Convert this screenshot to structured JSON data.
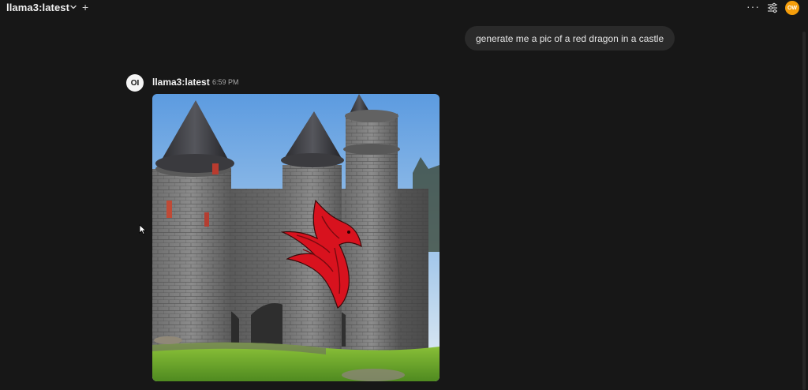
{
  "header": {
    "model_title": "llama3:latest",
    "new_chat_icon": "plus-icon",
    "more_icon": "ellipsis-icon",
    "settings_icon": "sliders-icon",
    "avatar_initials": "OW"
  },
  "colors": {
    "background": "#171717",
    "bubble": "#2a2a2a",
    "avatar": "#f59e0b"
  },
  "messages": [
    {
      "role": "user",
      "text": "generate me a pic of a red dragon in a castle"
    },
    {
      "role": "assistant",
      "logo_text": "OI",
      "model": "llama3:latest",
      "time": "6:59 PM",
      "image": "generated-image"
    }
  ]
}
